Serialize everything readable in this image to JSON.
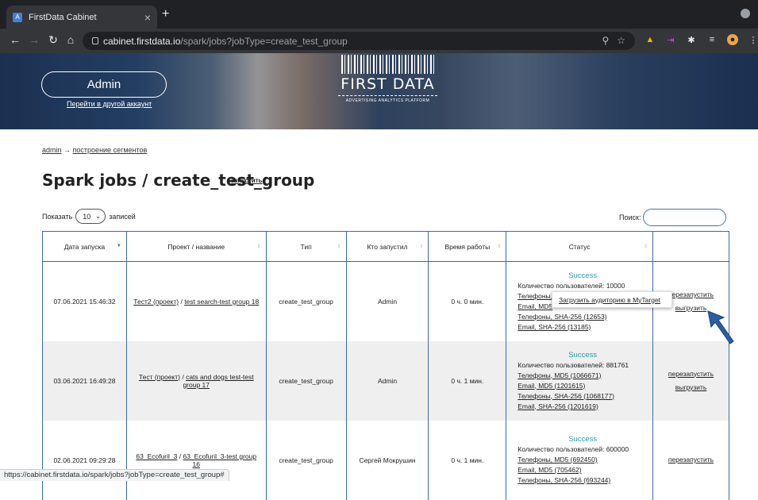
{
  "browser": {
    "tab_title": "FirstData Cabinet",
    "url_host": "cabinet.firstdata.io",
    "url_path": "/spark/jobs?jobType=create_test_group"
  },
  "banner": {
    "user_button": "Admin",
    "switch_account": "Перейти в другой аккаунт",
    "logo_title": "FIRST DATA",
    "logo_subtitle": "ADVERTISING ANALYTICS PLATFORM"
  },
  "breadcrumb": {
    "root": "admin",
    "separator": "→",
    "current": "построение сегментов"
  },
  "page": {
    "title": "Spark jobs / create_test_group",
    "run_link": "запустить"
  },
  "controls": {
    "show_label": "Показать",
    "page_size": "10",
    "entries_label": "записей",
    "search_label": "Поиск:"
  },
  "table": {
    "headers": [
      "Дата запуска",
      "Проект / название",
      "Тип",
      "Кто запустил",
      "Время работы",
      "Статус",
      ""
    ],
    "rows": [
      {
        "date": "07.06.2021 15:46:32",
        "project": "Тест2 (проект)",
        "sep": " / ",
        "name": "test search-test group 18",
        "type": "create_test_group",
        "user": "Admin",
        "duration": "0 ч. 0 мин.",
        "status": "Success",
        "users": "Количество пользователей: 10000",
        "l1": "Телефоны, MD5",
        "l2": "Email, MD5",
        "l3": "Телефоны, SHA-256 (12653)",
        "l4": "Email, SHA-256 (13185)",
        "a1": "перезапустить",
        "a2": "выгрузить"
      },
      {
        "date": "03.06.2021 16:49:28",
        "project": "Тест (проект)",
        "sep": " / ",
        "name": "cats and dogs test-test group 17",
        "type": "create_test_group",
        "user": "Admin",
        "duration": "0 ч. 1 мин.",
        "status": "Success",
        "users": "Количество пользователей: 881761",
        "l1": "Телефоны, MD5 (1066671)",
        "l2": "Email, MD5 (1201615)",
        "l3": "Телефоны, SHA-256 (1068177)",
        "l4": "Email, SHA-256 (1201619)",
        "a1": "перезапустить",
        "a2": "выгрузить"
      },
      {
        "date": "02.06.2021 09:29:28",
        "project": "63_Ecofuril_3",
        "sep": " / ",
        "name": "63_Ecofuril_3-test group 16",
        "type": "create_test_group",
        "user": "Сергей Мокрушин",
        "duration": "0 ч. 1 мин.",
        "status": "Success",
        "users": "Количество пользователей: 600000",
        "l1": "Телефоны, MD5 (692450)",
        "l2": "Email, MD5 (705462)",
        "l3": "Телефоны, SHA-256 (693244)",
        "l4": "",
        "a1": "перезапустить",
        "a2": ""
      }
    ]
  },
  "popup": {
    "label": "Загрузить аудиторию в MyTarget"
  },
  "statusbar": {
    "url": "https://cabinet.firstdata.io/spark/jobs?jobType=create_test_group#"
  }
}
